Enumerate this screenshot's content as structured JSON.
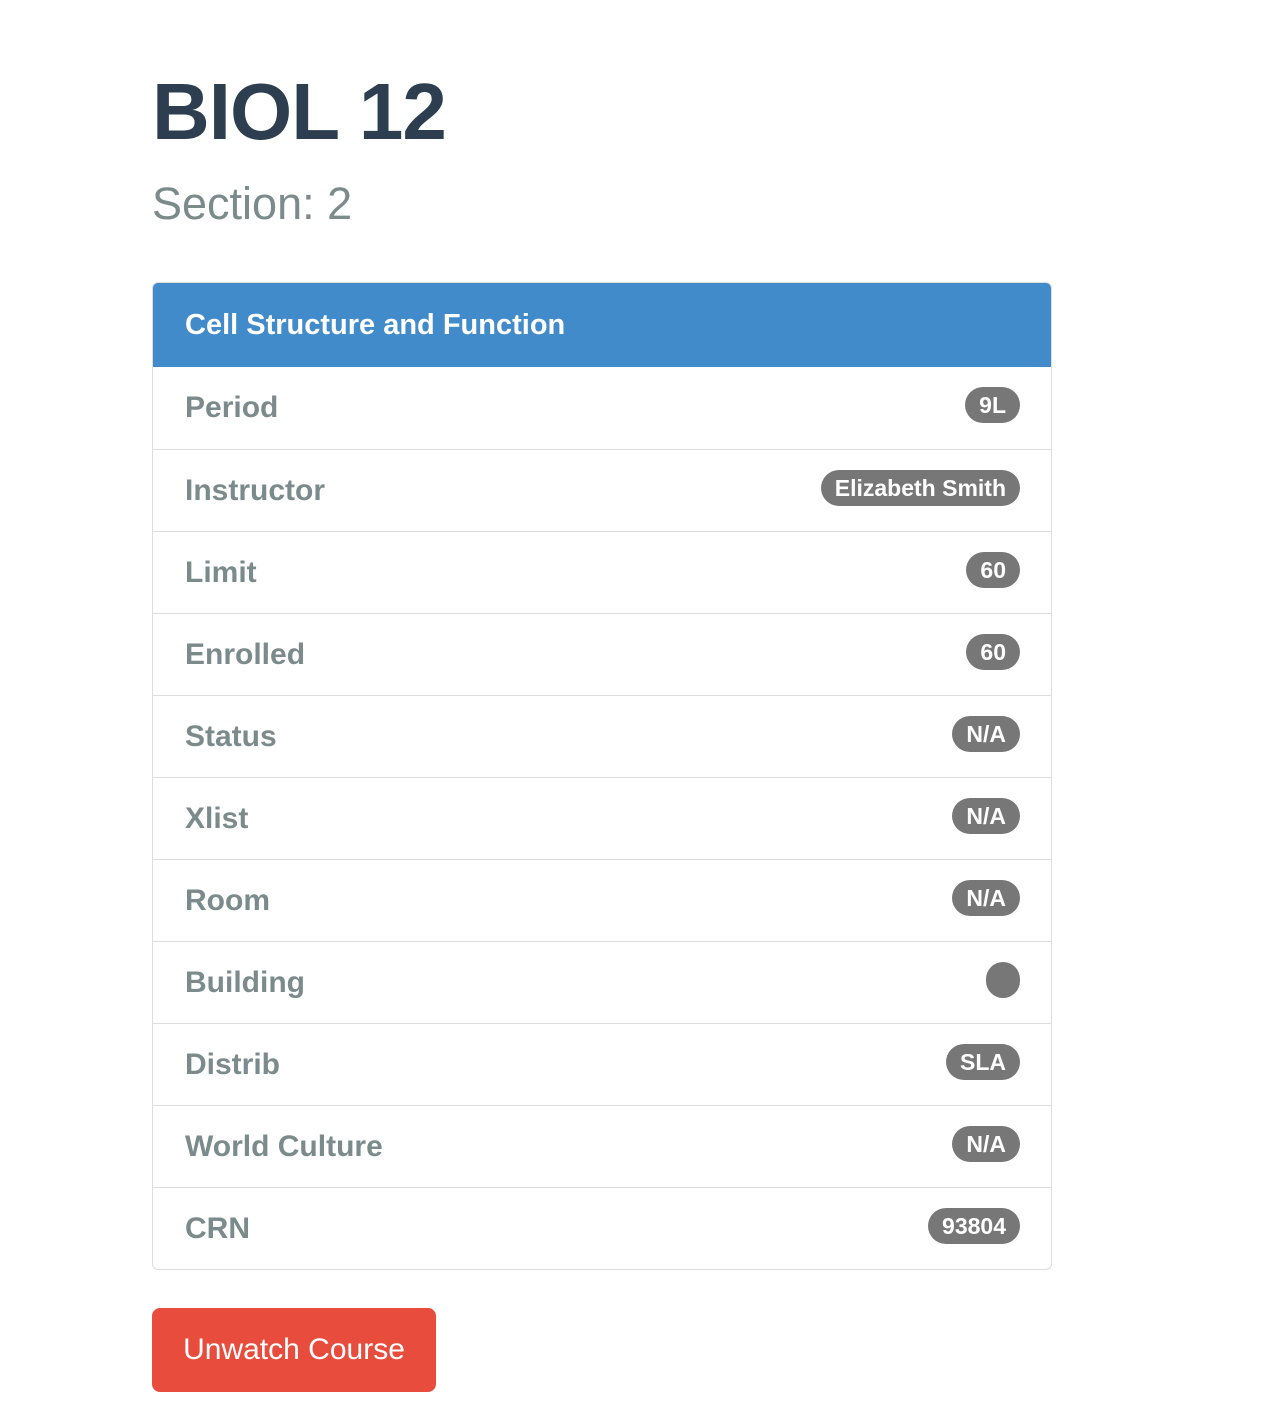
{
  "course": {
    "code": "BIOL 12",
    "section_label": "Section: 2"
  },
  "panel": {
    "title": "Cell Structure and Function",
    "items": [
      {
        "label": "Period",
        "value": "9L"
      },
      {
        "label": "Instructor",
        "value": "Elizabeth Smith"
      },
      {
        "label": "Limit",
        "value": "60"
      },
      {
        "label": "Enrolled",
        "value": "60"
      },
      {
        "label": "Status",
        "value": "N/A"
      },
      {
        "label": "Xlist",
        "value": "N/A"
      },
      {
        "label": "Room",
        "value": "N/A"
      },
      {
        "label": "Building",
        "value": ""
      },
      {
        "label": "Distrib",
        "value": "SLA"
      },
      {
        "label": "World Culture",
        "value": "N/A"
      },
      {
        "label": "CRN",
        "value": "93804"
      }
    ]
  },
  "actions": {
    "unwatch_label": "Unwatch Course"
  },
  "colors": {
    "heading": "#2c3e50",
    "muted": "#7b8a8b",
    "panel_primary": "#428bca",
    "badge": "#777777",
    "danger": "#e74c3c"
  }
}
